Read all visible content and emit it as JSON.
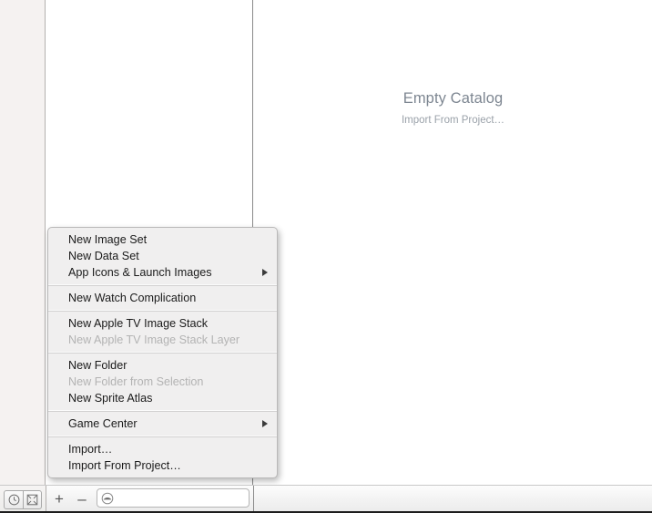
{
  "editor": {
    "empty_title": "Empty Catalog",
    "empty_subtitle": "Import From Project…"
  },
  "bottom_bar": {
    "history_icon": "clock-icon",
    "issues_icon": "boxed-x-icon",
    "add_label": "+",
    "remove_label": "–",
    "filter_placeholder": "",
    "filter_value": "",
    "filter_icon": "filter-circle-icon"
  },
  "context_menu": {
    "groups": [
      {
        "items": [
          {
            "label": "New Image Set",
            "disabled": false,
            "submenu": false
          },
          {
            "label": "New Data Set",
            "disabled": false,
            "submenu": false
          },
          {
            "label": "App Icons & Launch Images",
            "disabled": false,
            "submenu": true
          }
        ]
      },
      {
        "items": [
          {
            "label": "New Watch Complication",
            "disabled": false,
            "submenu": false
          }
        ]
      },
      {
        "items": [
          {
            "label": "New Apple TV Image Stack",
            "disabled": false,
            "submenu": false
          },
          {
            "label": "New Apple TV Image Stack Layer",
            "disabled": true,
            "submenu": false
          }
        ]
      },
      {
        "items": [
          {
            "label": "New Folder",
            "disabled": false,
            "submenu": false
          },
          {
            "label": "New Folder from Selection",
            "disabled": true,
            "submenu": false
          },
          {
            "label": "New Sprite Atlas",
            "disabled": false,
            "submenu": false
          }
        ]
      },
      {
        "items": [
          {
            "label": "Game Center",
            "disabled": false,
            "submenu": true
          }
        ]
      },
      {
        "items": [
          {
            "label": "Import…",
            "disabled": false,
            "submenu": false
          },
          {
            "label": "Import From Project…",
            "disabled": false,
            "submenu": false
          }
        ]
      }
    ]
  },
  "colors": {
    "menu_background": "#f0efef",
    "menu_border": "#b9b8b8",
    "disabled_text": "#b3b3b3",
    "empty_title": "#7d8691",
    "empty_subtitle": "#9aa1a9",
    "left_strip": "#f5f2f1",
    "divider": "#8a8a8a"
  }
}
